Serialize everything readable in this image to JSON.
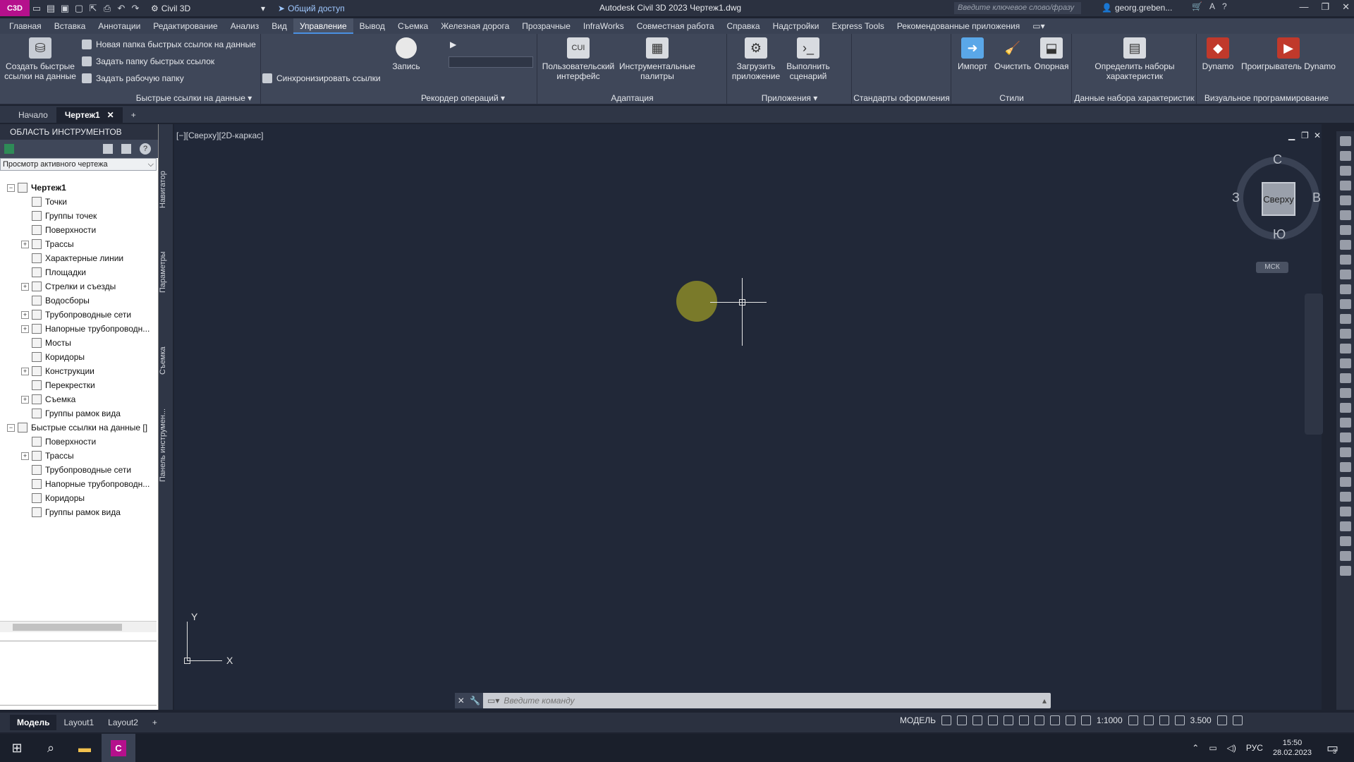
{
  "titlebar": {
    "logo": "C3D",
    "workspace": "Civil 3D",
    "share": "Общий доступ",
    "title": "Autodesk Civil 3D 2023    Чертеж1.dwg",
    "search_placeholder": "Введите ключевое слово/фразу",
    "user": "georg.greben..."
  },
  "ribbon_tabs": [
    "Главная",
    "Вставка",
    "Аннотации",
    "Редактирование",
    "Анализ",
    "Вид",
    "Управление",
    "Вывод",
    "Съемка",
    "Железная дорога",
    "Прозрачные",
    "InfraWorks",
    "Совместная работа",
    "Справка",
    "Надстройки",
    "Express Tools",
    "Рекомендованные приложения"
  ],
  "ribbon_active": "Управление",
  "ribbon": {
    "create_shortcuts": "Создать быстрые\nссылки на данные",
    "new_folder": "Новая папка быстрых ссылок на данные",
    "set_folder": "Задать папку быстрых ссылок",
    "set_workfolder": "Задать рабочую папку",
    "sync": "Синхронизировать ссылки",
    "panel_shortcuts": "Быстрые ссылки на данные ▾",
    "record": "Запись",
    "panel_recorder": "Рекордер операций ▾",
    "cui": "Пользовательский\nинтерфейс",
    "toolpalettes": "Инструментальные\nпалитры",
    "panel_adapt": "Адаптация",
    "load_app": "Загрузить\nприложение",
    "run_script": "Выполнить\nсценарий",
    "panel_apps": "Приложения ▾",
    "panel_standards": "Стандарты оформления",
    "import": "Импорт",
    "purge": "Очистить",
    "reference": "Опорная",
    "panel_styles": "Стили",
    "define_sets": "Определить наборы\nхарактеристик",
    "panel_propsets": "Данные набора характеристик",
    "dynamo": "Dynamo",
    "dynamo_player": "Проигрыватель Dynamo",
    "panel_visual": "Визуальное программирование"
  },
  "doctabs": {
    "start": "Начало",
    "drawing": "Чертеж1"
  },
  "palette": {
    "title": "ОБЛАСТЬ ИНСТРУМЕНТОВ",
    "view_select": "Просмотр активного чертежа",
    "side_tabs": [
      "Навигатор",
      "Параметры",
      "Съемка",
      "Панель инструмен..."
    ],
    "tree": [
      {
        "label": "Чертеж1",
        "level": 0,
        "exp": "-",
        "bold": true
      },
      {
        "label": "Точки",
        "level": 1,
        "exp": ""
      },
      {
        "label": "Группы точек",
        "level": 1,
        "exp": ""
      },
      {
        "label": "Поверхности",
        "level": 1,
        "exp": ""
      },
      {
        "label": "Трассы",
        "level": 1,
        "exp": "+"
      },
      {
        "label": "Характерные линии",
        "level": 1,
        "exp": ""
      },
      {
        "label": "Площадки",
        "level": 1,
        "exp": ""
      },
      {
        "label": "Стрелки и съезды",
        "level": 1,
        "exp": "+"
      },
      {
        "label": "Водосборы",
        "level": 1,
        "exp": ""
      },
      {
        "label": "Трубопроводные сети",
        "level": 1,
        "exp": "+"
      },
      {
        "label": "Напорные трубопроводн...",
        "level": 1,
        "exp": "+"
      },
      {
        "label": "Мосты",
        "level": 1,
        "exp": ""
      },
      {
        "label": "Коридоры",
        "level": 1,
        "exp": ""
      },
      {
        "label": "Конструкции",
        "level": 1,
        "exp": "+"
      },
      {
        "label": "Перекрестки",
        "level": 1,
        "exp": ""
      },
      {
        "label": "Съемка",
        "level": 1,
        "exp": "+"
      },
      {
        "label": "Группы рамок вида",
        "level": 1,
        "exp": ""
      },
      {
        "label": "Быстрые ссылки на данные []",
        "level": 0,
        "exp": "-"
      },
      {
        "label": "Поверхности",
        "level": 1,
        "exp": ""
      },
      {
        "label": "Трассы",
        "level": 1,
        "exp": "+"
      },
      {
        "label": "Трубопроводные сети",
        "level": 1,
        "exp": ""
      },
      {
        "label": "Напорные трубопроводн...",
        "level": 1,
        "exp": ""
      },
      {
        "label": "Коридоры",
        "level": 1,
        "exp": ""
      },
      {
        "label": "Группы рамок вида",
        "level": 1,
        "exp": ""
      }
    ]
  },
  "viewport": {
    "label": "[−][Сверху][2D-каркас]",
    "viewcube": {
      "face": "Сверху",
      "n": "С",
      "s": "Ю",
      "e": "В",
      "w": "З",
      "wcs": "МСК"
    },
    "ucs_x": "X",
    "ucs_y": "Y"
  },
  "command": {
    "placeholder": "Введите команду"
  },
  "layouts": [
    "Модель",
    "Layout1",
    "Layout2"
  ],
  "status": {
    "mode": "МОДЕЛЬ",
    "scale": "1:1000",
    "value": "3.500"
  },
  "taskbar": {
    "lang": "РУС",
    "time": "15:50",
    "date": "28.02.2023",
    "notif": "3"
  }
}
